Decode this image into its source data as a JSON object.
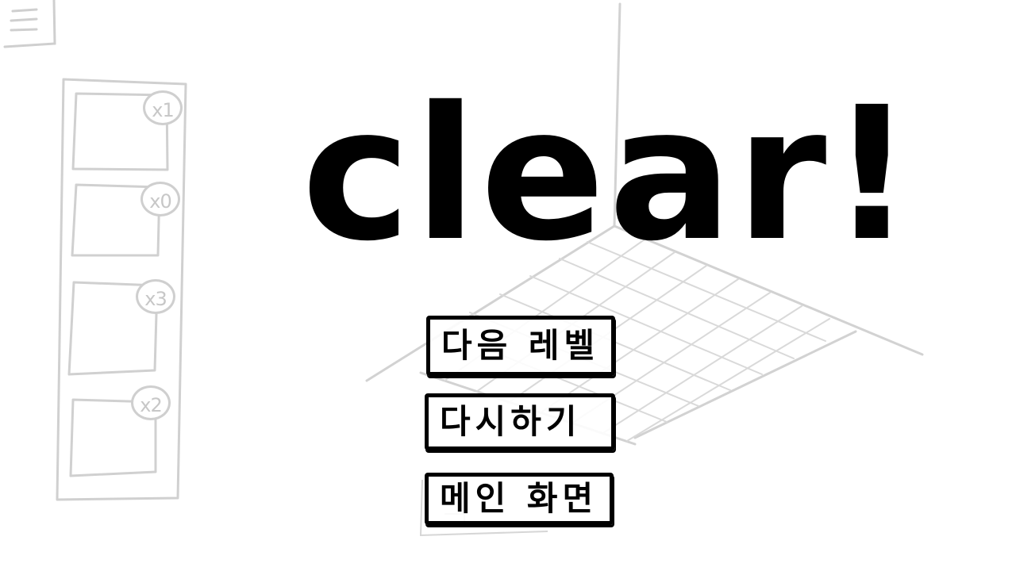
{
  "title": "clear!",
  "item_slots": [
    {
      "count": "x1"
    },
    {
      "count": "x0"
    },
    {
      "count": "x3"
    },
    {
      "count": "x2"
    }
  ],
  "buttons": {
    "next_level": "다음 레벨",
    "retry": "다시하기",
    "main_screen": "메인 화면"
  },
  "icons": {
    "menu": "hamburger-menu-icon"
  },
  "colors": {
    "ink": "#000000",
    "sketch_gray": "#cfcfcf",
    "background": "#ffffff"
  }
}
